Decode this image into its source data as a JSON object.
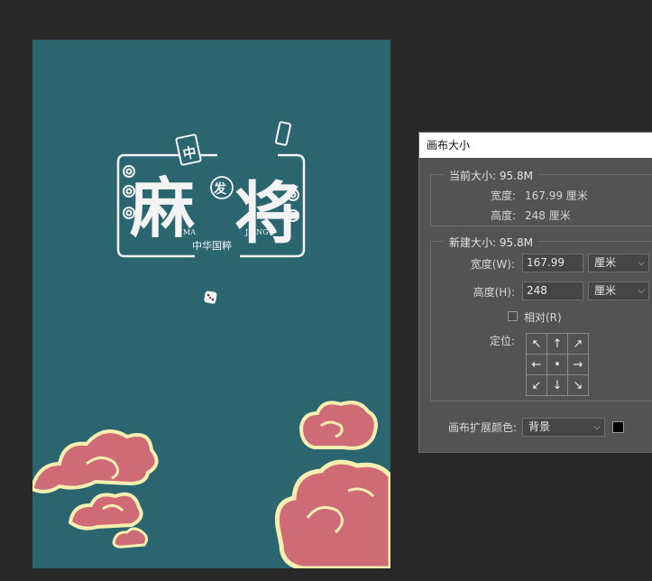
{
  "poster": {
    "background": "#2b6570",
    "logo": {
      "title_char_1": "麻",
      "title_char_2": "将",
      "tile_char": "中",
      "circle_char": "发",
      "pinyin_left": "MA",
      "pinyin_right": "JIANG",
      "subtitle": "中华国粹"
    },
    "cloud_colors": {
      "fill": "#cf6a77",
      "outline": "#f6efb0"
    }
  },
  "dialog": {
    "title": "画布大小",
    "current": {
      "legend": "当前大小: 95.8M",
      "width_label": "宽度:",
      "width_value": "167.99 厘米",
      "height_label": "高度:",
      "height_value": "248 厘米"
    },
    "new": {
      "legend": "新建大小: 95.8M",
      "width_label": "宽度(W):",
      "width_value": "167.99",
      "width_unit": "厘米",
      "height_label": "高度(H):",
      "height_value": "248",
      "height_unit": "厘米",
      "relative_label": "相对(R)",
      "relative_checked": false,
      "anchor_label": "定位:",
      "anchor_arrows": [
        "↖",
        "↑",
        "↗",
        "←",
        "•",
        "→",
        "↙",
        "↓",
        "↘"
      ]
    },
    "extension_color": {
      "label": "画布扩展颜色:",
      "value": "背景",
      "swatch": "#000000"
    }
  }
}
